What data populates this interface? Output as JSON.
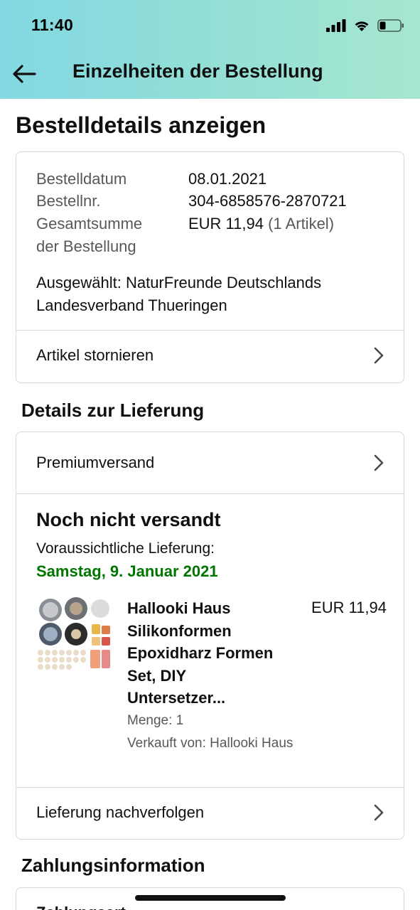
{
  "status_bar": {
    "time": "11:40"
  },
  "header": {
    "title": "Einzelheiten der Bestellung"
  },
  "page_title": "Bestelldetails anzeigen",
  "order": {
    "date_label": "Bestelldatum",
    "date_value": "08.01.2021",
    "number_label": "Bestellnr.",
    "number_value": "304-6858576-2870721",
    "total_label_line1": "Gesamtsumme",
    "total_label_line2": "der Bestellung",
    "total_value": "EUR 11,94",
    "total_items": "(1 Artikel)",
    "charity_line1": "Ausgewählt: NaturFreunde Deutschlands",
    "charity_line2": "Landesverband Thueringen",
    "cancel_label": "Artikel stornieren"
  },
  "delivery": {
    "section_title": "Details zur Lieferung",
    "shipping_method": "Premiumversand",
    "status": "Noch nicht versandt",
    "expected_label": "Voraussichtliche Lieferung:",
    "expected_date": "Samstag, 9. Januar 2021",
    "item": {
      "title_lines": [
        "Hallooki Haus",
        "Silikonformen",
        "Epoxidharz Formen",
        "Set, DIY",
        "Untersetzer..."
      ],
      "price": "EUR 11,94",
      "quantity": "Menge: 1",
      "seller": "Verkauft von: Hallooki Haus"
    },
    "track_label": "Lieferung nachverfolgen"
  },
  "payment": {
    "section_title": "Zahlungsinformation",
    "peek_text": "Zahlungsart"
  },
  "colors": {
    "delivery_date": "#007600",
    "label_gray": "#565959",
    "border": "#d5d9d9"
  }
}
